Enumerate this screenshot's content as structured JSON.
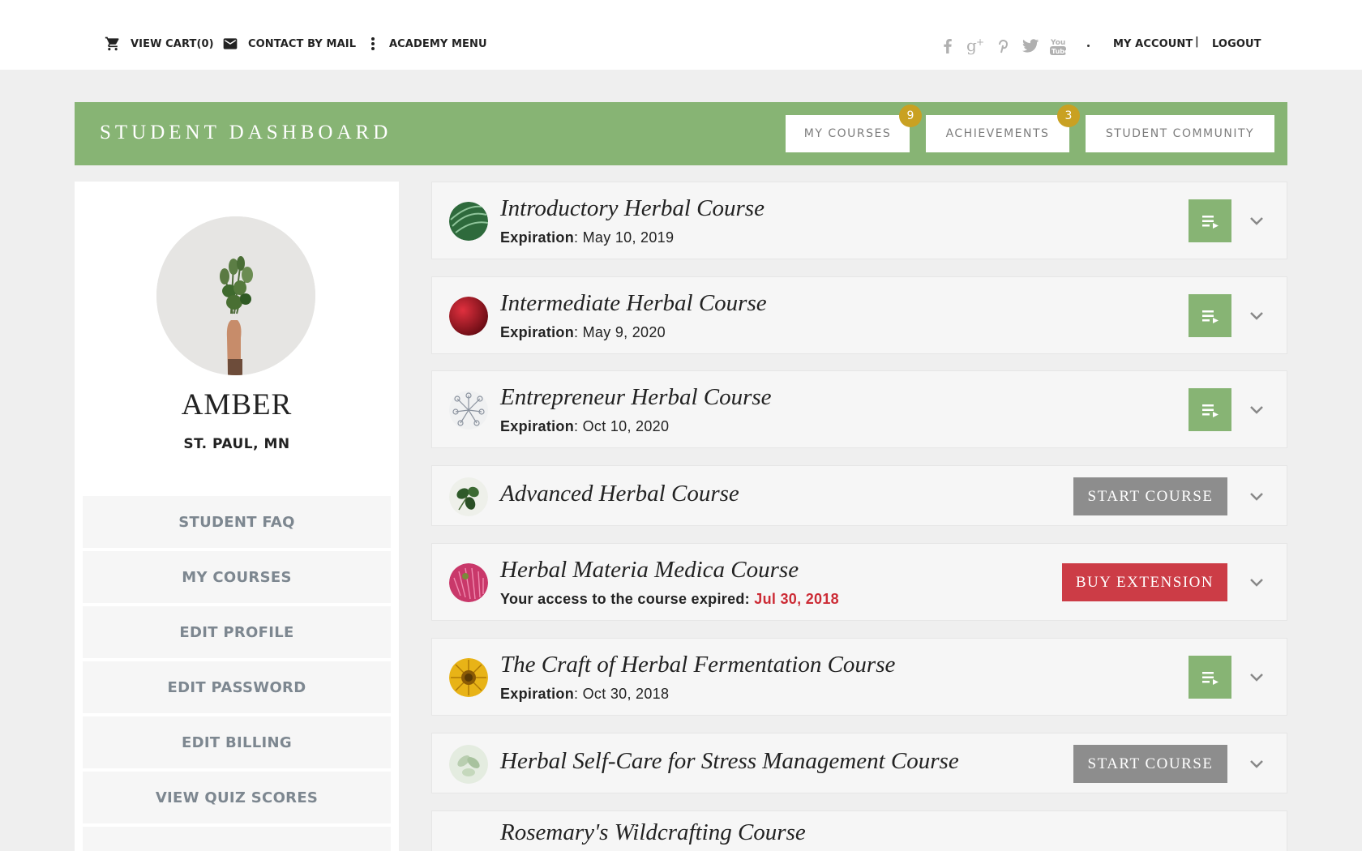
{
  "topbar": {
    "view_cart": "VIEW CART(0)",
    "contact": "CONTACT BY MAIL",
    "academy_menu": "ACADEMY MENU",
    "social_icons": [
      "facebook-icon",
      "google-plus-icon",
      "pinterest-icon",
      "twitter-icon",
      "youtube-icon"
    ],
    "my_account": "MY ACCOUNT",
    "separator": "|",
    "logout": "LOGOUT"
  },
  "header": {
    "title": "STUDENT DASHBOARD",
    "tabs": [
      {
        "label": "MY COURSES",
        "badge": "9"
      },
      {
        "label": "ACHIEVEMENTS",
        "badge": "3"
      },
      {
        "label": "STUDENT COMMUNITY"
      }
    ],
    "accent": "#87b474",
    "badge_color": "#c9a122"
  },
  "profile": {
    "name": "AMBER",
    "location": "ST. PAUL, MN"
  },
  "sidebar": {
    "items": [
      {
        "label": "STUDENT FAQ"
      },
      {
        "label": "MY COURSES"
      },
      {
        "label": "EDIT PROFILE"
      },
      {
        "label": "EDIT PASSWORD"
      },
      {
        "label": "EDIT BILLING"
      },
      {
        "label": "VIEW QUIZ SCORES"
      }
    ]
  },
  "courses": [
    {
      "title": "Introductory Herbal Course",
      "exp_label": "Expiration",
      "exp_sep": ": ",
      "exp_date": "May 10, 2019",
      "action": "play"
    },
    {
      "title": "Intermediate Herbal Course",
      "exp_label": "Expiration",
      "exp_sep": ": ",
      "exp_date": "May 9, 2020",
      "action": "play"
    },
    {
      "title": "Entrepreneur Herbal Course",
      "exp_label": "Expiration",
      "exp_sep": ": ",
      "exp_date": "Oct 10, 2020",
      "action": "play"
    },
    {
      "title": "Advanced Herbal Course",
      "action": "start",
      "action_label": "START COURSE"
    },
    {
      "title": "Herbal Materia Medica Course",
      "expired_text": "Your access to the course expired: ",
      "expired_date": "Jul 30, 2018",
      "action": "buy",
      "action_label": "BUY EXTENSION"
    },
    {
      "title": "The Craft of Herbal Fermentation Course",
      "exp_label": "Expiration",
      "exp_sep": ": ",
      "exp_date": "Oct 30, 2018",
      "action": "play"
    },
    {
      "title": "Herbal Self-Care for Stress Management Course",
      "action": "start",
      "action_label": "START COURSE"
    },
    {
      "title": "Rosemary's Wildcrafting Course"
    }
  ],
  "colors": {
    "expired_red": "#cc2b35",
    "buy_red": "#cc3c46",
    "start_gray": "#8d8d8d"
  }
}
